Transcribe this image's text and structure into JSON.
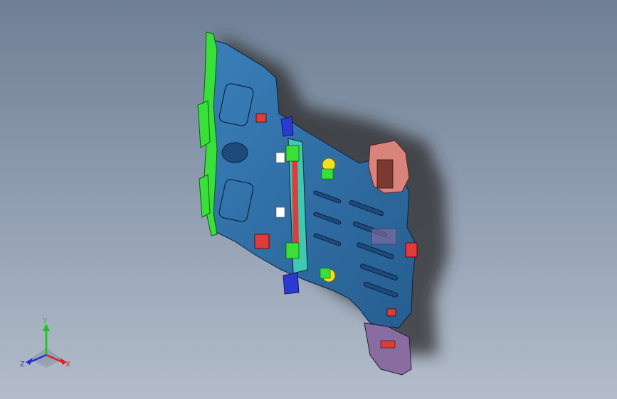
{
  "viewport": {
    "background_top": "#6f7f95",
    "background_bottom": "#b3bdca"
  },
  "model": {
    "body_color": "#2e6fa6",
    "rail_color": "#39e03a",
    "clamp_color": "#e03a3a",
    "bracket_color": "#d8847a",
    "plate_color": "#8a6da0",
    "pin_color": "#f0e020",
    "block_color": "#2a3ad0",
    "slot_color": "#1e4a7a",
    "shadow_color": "#2b2b2b"
  },
  "triad": {
    "x_label": "X",
    "y_label": "Y",
    "z_label": "Z",
    "x_color": "#e02020",
    "y_color": "#20c020",
    "z_color": "#2030e0"
  }
}
